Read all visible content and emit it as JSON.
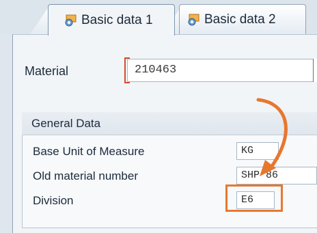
{
  "tabs": [
    {
      "label": "Basic data 1",
      "icon": "document-folder-icon",
      "active": true
    },
    {
      "label": "Basic data 2",
      "icon": "document-folder-icon",
      "active": false
    }
  ],
  "material": {
    "label": "Material",
    "value": "210463"
  },
  "general_data": {
    "title": "General Data",
    "rows": [
      {
        "label": "Base Unit of Measure",
        "value": "KG"
      },
      {
        "label": "Old material number",
        "value": "SHP 86"
      },
      {
        "label": "Division",
        "value": "E6"
      }
    ]
  },
  "colors": {
    "accent": "#e8772e",
    "required_mark": "#d84a2a"
  }
}
